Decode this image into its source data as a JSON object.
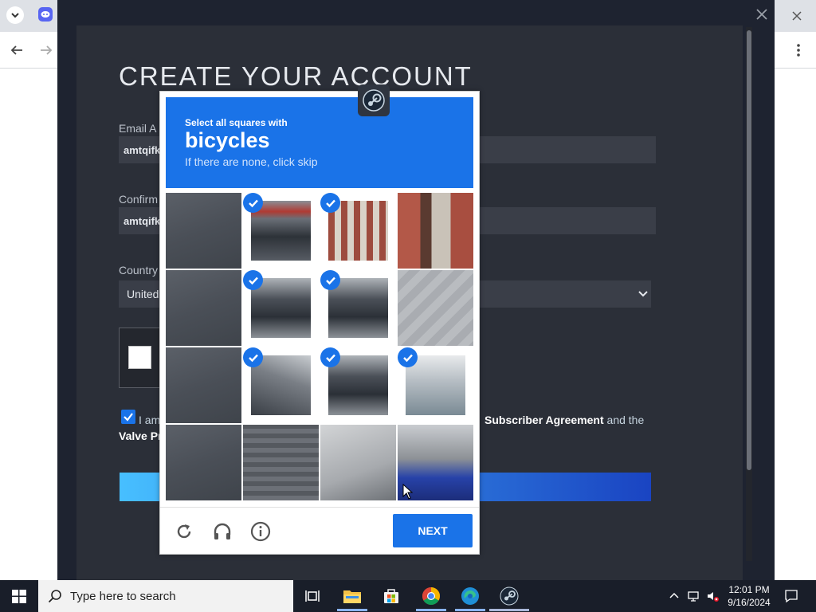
{
  "steam": {
    "title": "CREATE YOUR ACCOUNT",
    "email_label": "Email A",
    "email_value": "amtqifk",
    "confirm_label": "Confirm",
    "confirm_value": "amtqifk",
    "country_label": "Country",
    "country_value": "United",
    "agree_prefix": "I am",
    "agree_link1": "Subscriber Agreement",
    "agree_and": "and the",
    "agree_line2": "Valve Pr"
  },
  "captcha": {
    "instruction_small": "Select all squares with",
    "target": "bicycles",
    "hint": "If there are none, click skip",
    "next_label": "NEXT",
    "tiles": [
      {
        "selected": false,
        "scene": "asphalt"
      },
      {
        "selected": true,
        "scene": "bikes-car"
      },
      {
        "selected": true,
        "scene": "bikes-pillars"
      },
      {
        "selected": false,
        "scene": "building"
      },
      {
        "selected": false,
        "scene": "asphalt"
      },
      {
        "selected": true,
        "scene": "bikes"
      },
      {
        "selected": true,
        "scene": "bikes"
      },
      {
        "selected": false,
        "scene": "sidewalk"
      },
      {
        "selected": false,
        "scene": "asphalt"
      },
      {
        "selected": true,
        "scene": "wheel"
      },
      {
        "selected": true,
        "scene": "bikes"
      },
      {
        "selected": true,
        "scene": "bike-blue"
      },
      {
        "selected": false,
        "scene": "asphalt"
      },
      {
        "selected": false,
        "scene": "cobble"
      },
      {
        "selected": false,
        "scene": "pavement"
      },
      {
        "selected": false,
        "scene": "scooter"
      }
    ]
  },
  "taskbar": {
    "search_placeholder": "Type here to search",
    "time": "12:01 PM",
    "date": "9/16/2024"
  },
  "icons": {
    "reload": "reload-icon",
    "audio": "headphones-icon",
    "info": "info-icon"
  },
  "colors": {
    "captcha_blue": "#1a73e8",
    "steam_bg": "#2b2f38",
    "taskbar": "#191e29"
  }
}
